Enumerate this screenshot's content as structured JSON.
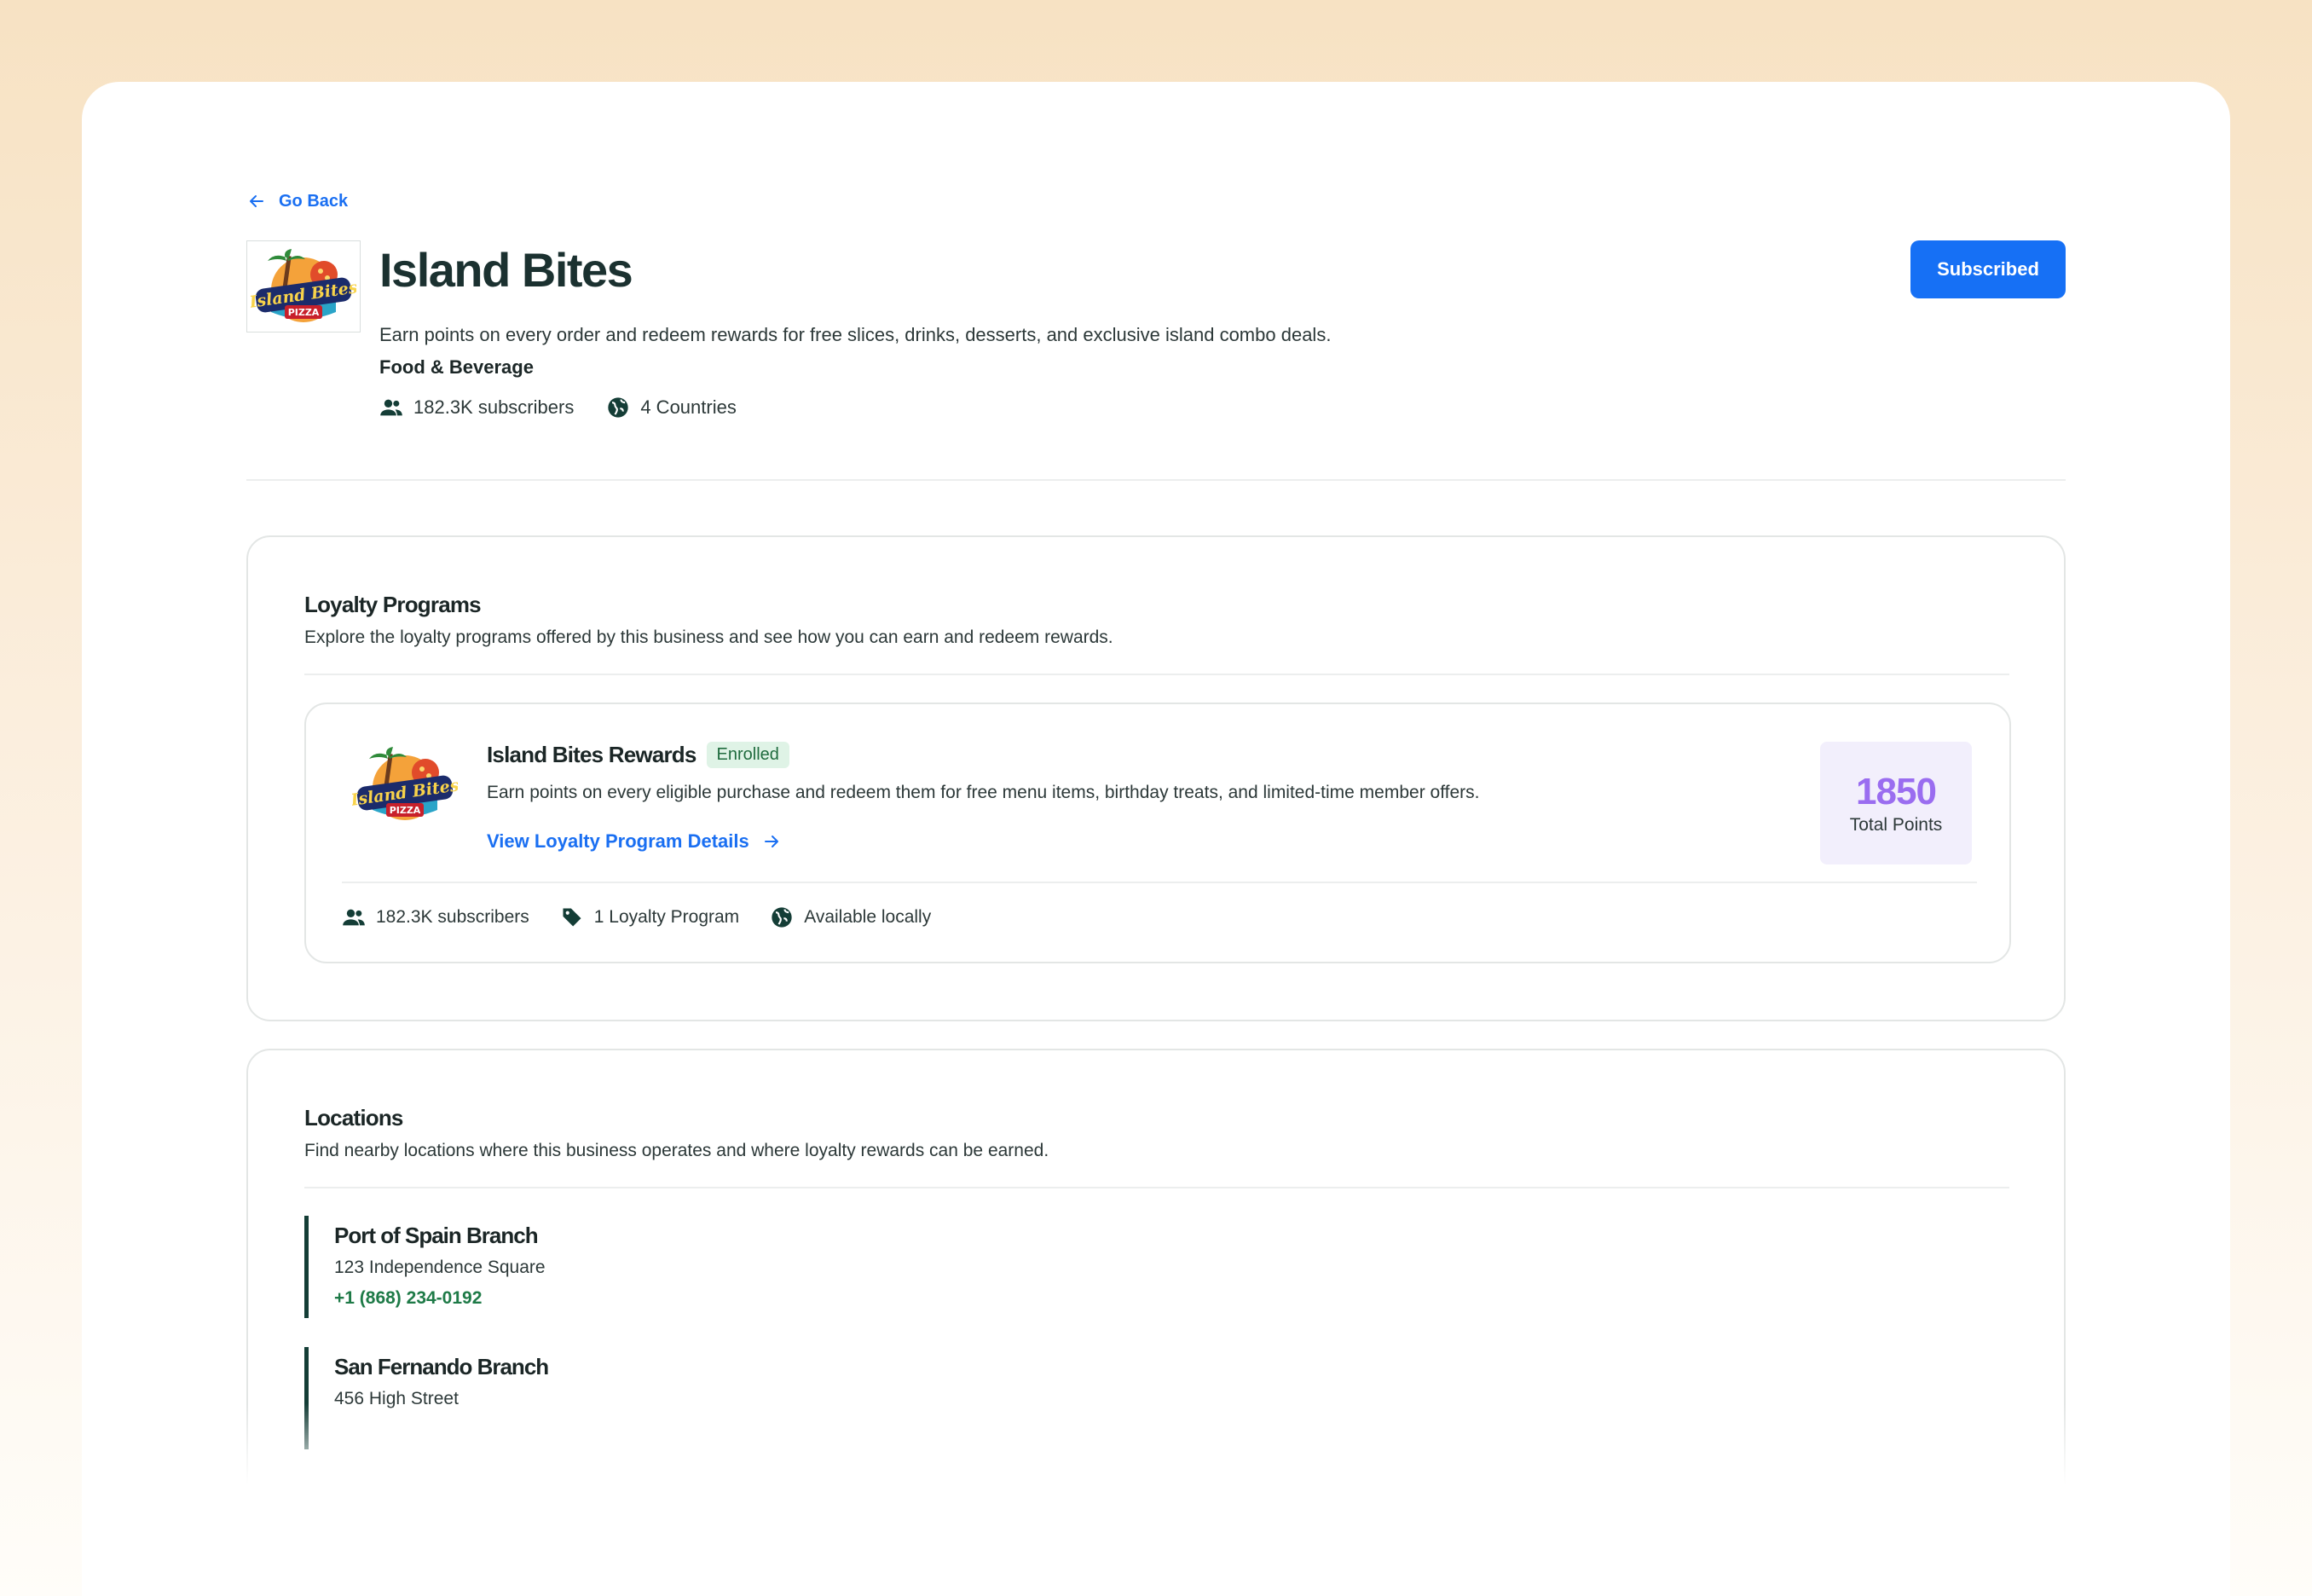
{
  "nav": {
    "go_back_label": "Go Back"
  },
  "business": {
    "name": "Island Bites",
    "description": "Earn points on every order and redeem rewards for free slices, drinks, desserts, and exclusive island combo deals.",
    "category": "Food & Beverage",
    "subscribers": "182.3K subscribers",
    "countries": "4 Countries",
    "subscribe_label": "Subscribed",
    "logo_text": "Island Bites",
    "logo_subtext": "PIZZA"
  },
  "loyalty": {
    "title": "Loyalty Programs",
    "subtitle": "Explore the loyalty programs offered by this business and see how you can earn and redeem rewards.",
    "program": {
      "name": "Island Bites Rewards",
      "badge": "Enrolled",
      "description": "Earn points on every eligible purchase and redeem them for free menu items, birthday treats, and limited-time member offers.",
      "link_label": "View Loyalty Program Details",
      "points_value": "1850",
      "points_label": "Total Points",
      "subscribers": "182.3K subscribers",
      "program_count": "1 Loyalty Program",
      "availability": "Available locally"
    }
  },
  "locations": {
    "title": "Locations",
    "subtitle": "Find nearby locations where this business operates and where loyalty rewards can be earned.",
    "items": [
      {
        "name": "Port of Spain Branch",
        "address": "123 Independence Square",
        "phone": "+1 (868) 234-0192"
      },
      {
        "name": "San Fernando Branch",
        "address": "456 High Street"
      }
    ]
  },
  "colors": {
    "primary": "#1670f5",
    "points": "#9a6df0",
    "badge_bg": "#dff3e6",
    "location_bar": "#143d36",
    "phone": "#1e7a47"
  }
}
